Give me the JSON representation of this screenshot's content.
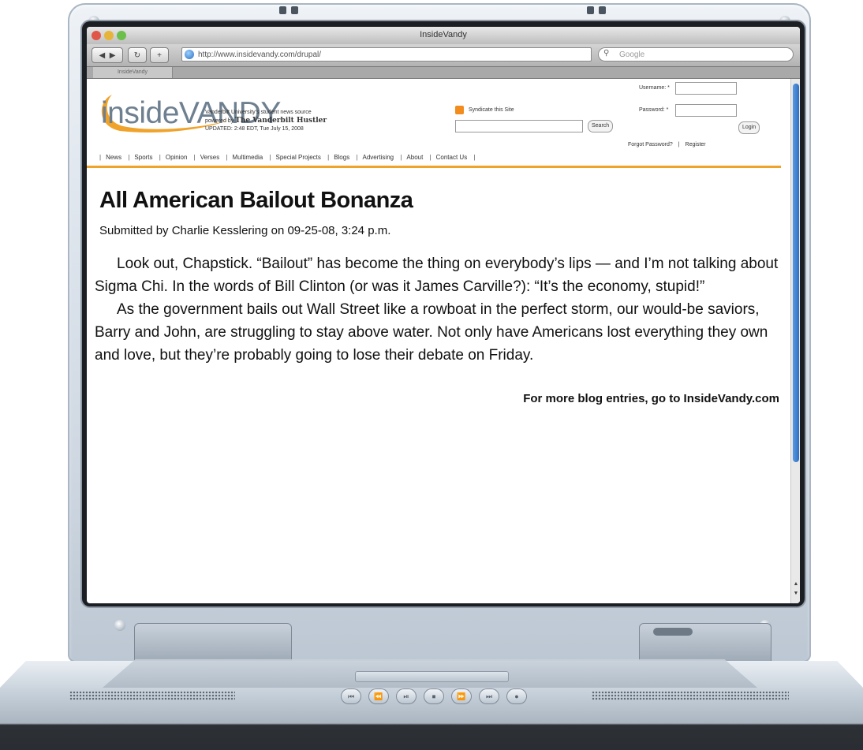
{
  "browser": {
    "window_title": "InsideVandy",
    "url": "http://www.insidevandy.com/drupal/",
    "search_placeholder": "Google",
    "tab_label": "InsideVandy"
  },
  "site": {
    "logo_text": "insideVANDY",
    "tagline_line1": "Vanderbilt University's student news source",
    "tagline_line2_prefix": "powered by",
    "tagline_paper": "The Vanderbilt Hustler",
    "tagline_line3": "UPDATED: 2:48 EDT, Tue July 15, 2008",
    "syndicate_label": "Syndicate this Site",
    "search_button": "Search",
    "username_label": "Username: *",
    "password_label": "Password: *",
    "login_button": "Login",
    "forgot_password": "Forgot Password?",
    "register": "Register",
    "nav": [
      "News",
      "Sports",
      "Opinion",
      "Verses",
      "Multimedia",
      "Special Projects",
      "Blogs",
      "Advertising",
      "About",
      "Contact Us"
    ]
  },
  "article": {
    "title": "All American Bailout Bonanza",
    "byline": "Submitted by Charlie Kesslering on 09-25-08, 3:24 p.m.",
    "paragraphs": [
      "Look out, Chapstick. “Bailout” has become the thing on everybody’s lips — and I’m not talking about Sigma Chi. In the words of Bill Clinton (or was it James Carville?): “It’s the economy, stupid!”",
      "As the government bails out Wall Street like a rowboat in the perfect storm, our would-be saviors, Barry and John, are struggling to stay above water. Not only have Americans lost everything they own and love, but they’re probably going to lose their debate on Friday."
    ],
    "more_link": "For more blog entries, go to InsideVandy.com"
  },
  "colors": {
    "nav_rule": "#f0a32a",
    "logo": "#6e7f90",
    "scroll_thumb": "#2f6fc4"
  },
  "icons": [
    "traffic-light-close-icon",
    "traffic-light-minimize-icon",
    "traffic-light-zoom-icon",
    "back-icon",
    "forward-icon",
    "reload-icon",
    "add-bookmark-icon",
    "globe-icon",
    "search-magnifier-icon",
    "rss-icon",
    "scroll-up-icon",
    "scroll-down-icon"
  ]
}
